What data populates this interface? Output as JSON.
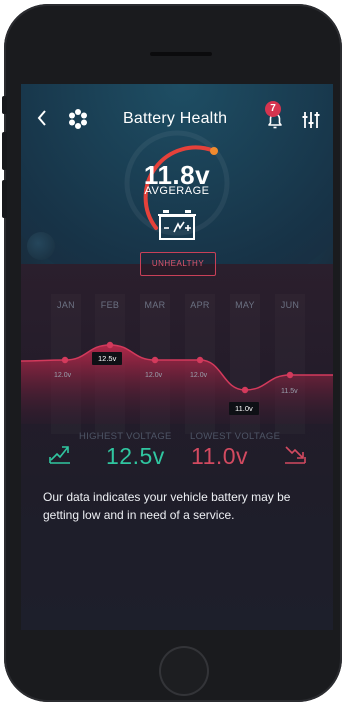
{
  "header": {
    "title": "Battery Health",
    "notification_count": "7",
    "back_icon": "chevron-left-icon",
    "menu_icon": "flower-icon",
    "bell_icon": "bell-icon",
    "filter_icon": "sliders-icon"
  },
  "gauge": {
    "voltage": "11.8v",
    "label": "AVGERAGE",
    "status": "UNHEALTHY",
    "status_color": "#e0566e",
    "arc_color": "#e5413a"
  },
  "chart_data": {
    "type": "area",
    "categories": [
      "JAN",
      "FEB",
      "MAR",
      "APR",
      "MAY",
      "JUN"
    ],
    "series": [
      {
        "values": [
          12.0,
          12.5,
          12.0,
          12.0,
          11.0,
          11.5
        ]
      }
    ],
    "data_labels": [
      "12.0v",
      "12.5v",
      "12.0v",
      "12.0v",
      "11.0v",
      "11.5v"
    ],
    "color": "#b8284a"
  },
  "stats": {
    "highest_label": "HIGHEST VOLTAGE",
    "highest_value": "12.5v",
    "lowest_label": "LOWEST VOLTAGE",
    "lowest_value": "11.0v",
    "highest_color": "#30c6a0",
    "lowest_color": "#d24a60"
  },
  "message": "Our data indicates your vehicle battery may be getting low and in need of a service."
}
